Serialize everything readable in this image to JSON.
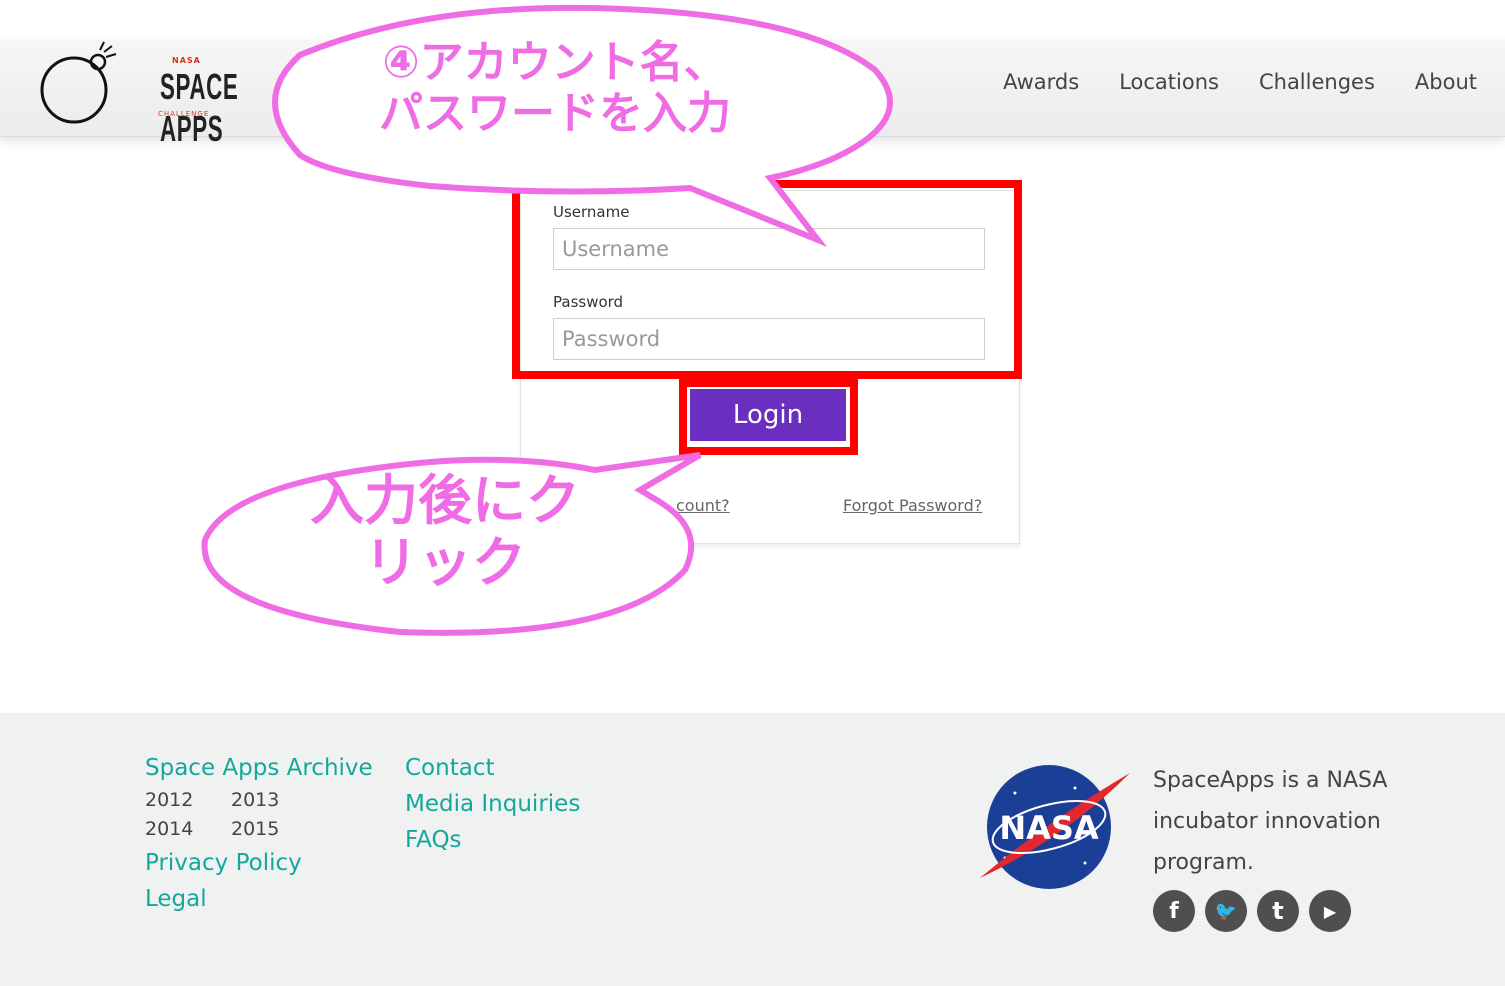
{
  "header": {
    "logo": {
      "nasa": "NASA",
      "title": "SPACE APPS",
      "subtitle": "CHALLENGE"
    },
    "nav": [
      {
        "label": "Awards"
      },
      {
        "label": "Locations"
      },
      {
        "label": "Challenges"
      },
      {
        "label": "About"
      }
    ]
  },
  "login": {
    "username_label": "Username",
    "username_placeholder": "Username",
    "password_label": "Password",
    "password_placeholder": "Password",
    "login_button": "Login",
    "create_account_link": "count?",
    "forgot_password_link": "Forgot Password?"
  },
  "annotations": {
    "callout_top_line1": "④アカウント名、",
    "callout_top_line2": "パスワードを入力",
    "callout_bottom_line1": "入力後にク",
    "callout_bottom_line2": "リック",
    "highlight_color": "#ff0000",
    "callout_color": "#f06ce4"
  },
  "footer": {
    "archive_label": "Space Apps Archive",
    "years": [
      "2012",
      "2013",
      "2014",
      "2015"
    ],
    "privacy": "Privacy Policy",
    "legal": "Legal",
    "contact": "Contact",
    "media": "Media Inquiries",
    "faqs": "FAQs",
    "description": "SpaceApps is a NASA incubator innovation program.",
    "nasa_logo_text": "NASA",
    "social": [
      {
        "icon": "facebook-icon",
        "glyph": "f"
      },
      {
        "icon": "twitter-icon",
        "glyph": "🐦"
      },
      {
        "icon": "tumblr-icon",
        "glyph": "t"
      },
      {
        "icon": "youtube-icon",
        "glyph": "▶"
      }
    ]
  },
  "colors": {
    "accent_purple": "#6b2fbf",
    "link_teal": "#13a89e",
    "footer_bg": "#f0f1f1"
  }
}
